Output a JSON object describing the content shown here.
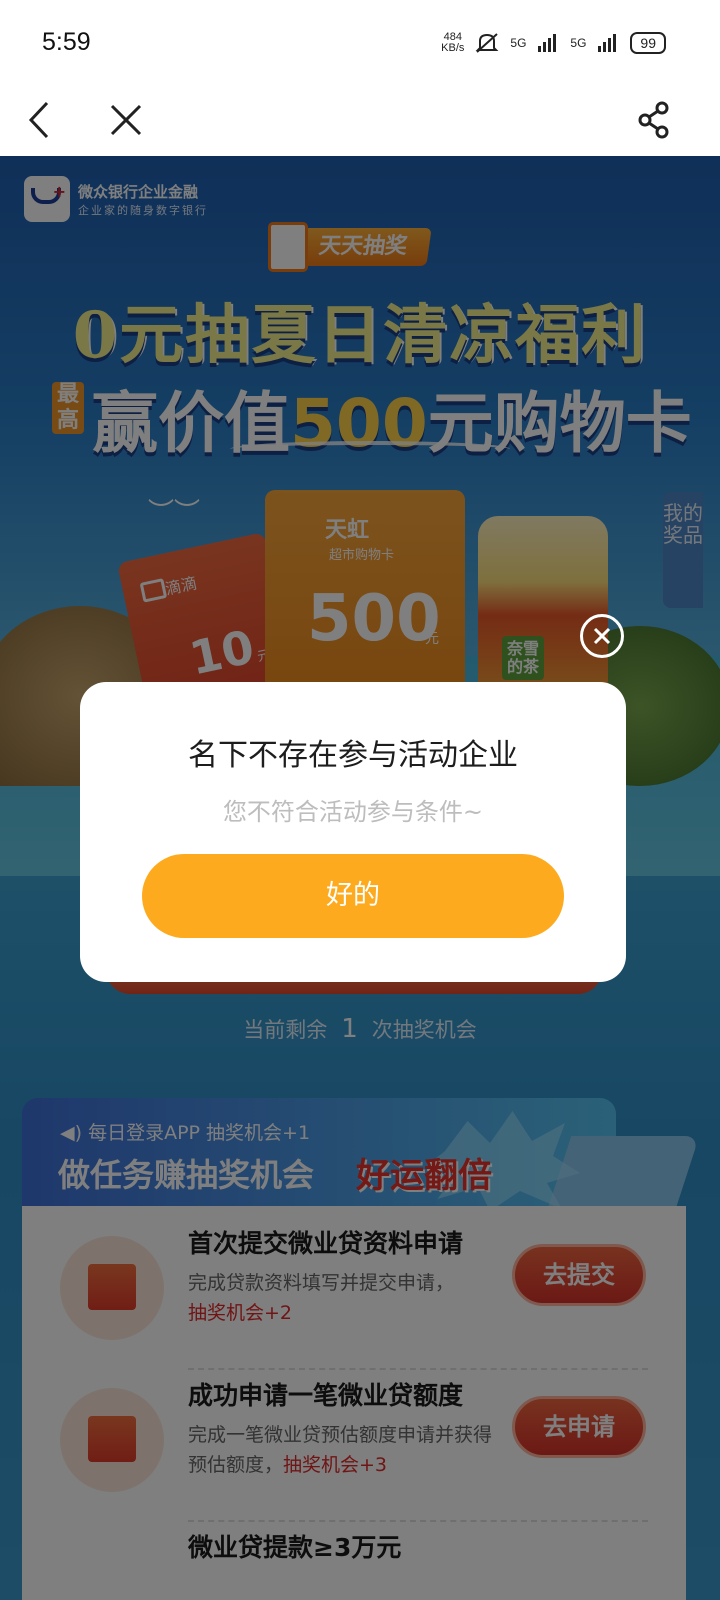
{
  "status_bar": {
    "time": "5:59",
    "speed_value": "484",
    "speed_unit": "KB/s",
    "signal1": "5G",
    "signal2": "5G",
    "battery": "99"
  },
  "nav": {
    "back_icon": "chevron-left-icon",
    "close_icon": "close-icon",
    "share_icon": "share-icon"
  },
  "brand": {
    "name": "微众银行企业金融",
    "slogan": "企业家的随身数字银行",
    "badge": "WeBank"
  },
  "campaign": {
    "tag": "天天抽奖",
    "headline1": "0元抽夏日清凉福利",
    "zuigao": "最高",
    "headline2_a": "赢价值",
    "headline2_num": "500",
    "headline2_b": "元购物卡"
  },
  "prizes": {
    "rainbow_brand": "天虹",
    "rainbow_card": "超市购物卡",
    "rainbow_value": "500",
    "rainbow_unit": "元",
    "didi_brand": "滴滴",
    "didi_value": "10",
    "didi_unit": "元",
    "drink_label": "奈雪的茶"
  },
  "my_prize": "我的奖品",
  "chance": {
    "prefix": "当前剩余",
    "count": "1",
    "suffix": "次抽奖机会"
  },
  "tasks": {
    "note": "每日登录APP 抽奖机会+1",
    "title": "做任务赚抽奖机会",
    "title_highlight": "好运翻倍",
    "items": [
      {
        "title": "首次提交微业贷资料申请",
        "desc": "完成贷款资料填写并提交申请，",
        "reward": "抽奖机会+2",
        "button": "去提交"
      },
      {
        "title": "成功申请一笔微业贷额度",
        "desc": "完成一笔微业贷预估额度申请并获得预估额度，",
        "reward": "抽奖机会+3",
        "button": "去申请"
      }
    ],
    "peek": "微业贷提款≥3万元"
  },
  "modal": {
    "title": "名下不存在参与活动企业",
    "subtitle": "您不符合活动参与条件~",
    "ok": "好的"
  },
  "colors": {
    "modal_button": "#fdaa1f",
    "task_button": "#d8322a",
    "page_blue": "#2a7dc7"
  }
}
